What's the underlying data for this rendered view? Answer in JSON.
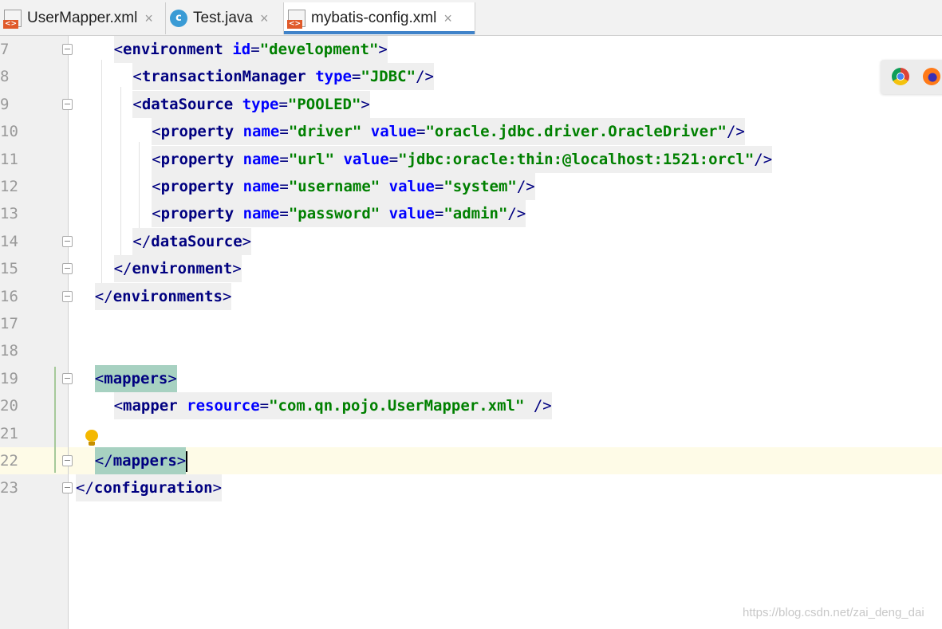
{
  "tabs": [
    {
      "label": "UserMapper.xml",
      "type": "xml",
      "active": false
    },
    {
      "label": "Test.java",
      "type": "java",
      "active": false
    },
    {
      "label": "mybatis-config.xml",
      "type": "xml",
      "active": true
    }
  ],
  "tab_close_glyph": "×",
  "java_icon_glyph": "c",
  "editor": {
    "lines": [
      {
        "n": "7",
        "tokens": [
          [
            "br",
            "<"
          ],
          [
            "tg",
            "environment"
          ],
          [
            "sp",
            " "
          ],
          [
            "at",
            "id"
          ],
          [
            "br",
            "="
          ],
          [
            "vl",
            "\"development\""
          ],
          [
            "br",
            ">"
          ]
        ]
      },
      {
        "n": "8",
        "tokens": [
          [
            "br",
            "<"
          ],
          [
            "tg",
            "transactionManager"
          ],
          [
            "sp",
            " "
          ],
          [
            "at",
            "type"
          ],
          [
            "br",
            "="
          ],
          [
            "vl",
            "\"JDBC\""
          ],
          [
            "br",
            "/>"
          ]
        ]
      },
      {
        "n": "9",
        "tokens": [
          [
            "br",
            "<"
          ],
          [
            "tg",
            "dataSource"
          ],
          [
            "sp",
            " "
          ],
          [
            "at",
            "type"
          ],
          [
            "br",
            "="
          ],
          [
            "vl",
            "\"POOLED\""
          ],
          [
            "br",
            ">"
          ]
        ]
      },
      {
        "n": "10",
        "tokens": [
          [
            "br",
            "<"
          ],
          [
            "tg",
            "property"
          ],
          [
            "sp",
            " "
          ],
          [
            "at",
            "name"
          ],
          [
            "br",
            "="
          ],
          [
            "vl",
            "\"driver\""
          ],
          [
            "sp",
            " "
          ],
          [
            "at",
            "value"
          ],
          [
            "br",
            "="
          ],
          [
            "vl",
            "\"oracle.jdbc.driver.OracleDriver\""
          ],
          [
            "br",
            "/>"
          ]
        ]
      },
      {
        "n": "11",
        "tokens": [
          [
            "br",
            "<"
          ],
          [
            "tg",
            "property"
          ],
          [
            "sp",
            " "
          ],
          [
            "at",
            "name"
          ],
          [
            "br",
            "="
          ],
          [
            "vl",
            "\"url\""
          ],
          [
            "sp",
            " "
          ],
          [
            "at",
            "value"
          ],
          [
            "br",
            "="
          ],
          [
            "vl",
            "\"jdbc:oracle:thin:@localhost:1521:orcl\""
          ],
          [
            "br",
            "/>"
          ]
        ]
      },
      {
        "n": "12",
        "tokens": [
          [
            "br",
            "<"
          ],
          [
            "tg",
            "property"
          ],
          [
            "sp",
            " "
          ],
          [
            "at",
            "name"
          ],
          [
            "br",
            "="
          ],
          [
            "vl",
            "\"username\""
          ],
          [
            "sp",
            " "
          ],
          [
            "at",
            "value"
          ],
          [
            "br",
            "="
          ],
          [
            "vl",
            "\"system\""
          ],
          [
            "br",
            "/>"
          ]
        ]
      },
      {
        "n": "13",
        "tokens": [
          [
            "br",
            "<"
          ],
          [
            "tg",
            "property"
          ],
          [
            "sp",
            " "
          ],
          [
            "at",
            "name"
          ],
          [
            "br",
            "="
          ],
          [
            "vl",
            "\"password\""
          ],
          [
            "sp",
            " "
          ],
          [
            "at",
            "value"
          ],
          [
            "br",
            "="
          ],
          [
            "vl",
            "\"admin\""
          ],
          [
            "br",
            "/>"
          ]
        ]
      },
      {
        "n": "14",
        "tokens": [
          [
            "br",
            "</"
          ],
          [
            "tg",
            "dataSource"
          ],
          [
            "br",
            ">"
          ]
        ]
      },
      {
        "n": "15",
        "tokens": [
          [
            "br",
            "</"
          ],
          [
            "tg",
            "environment"
          ],
          [
            "br",
            ">"
          ]
        ]
      },
      {
        "n": "16",
        "tokens": [
          [
            "br",
            "</"
          ],
          [
            "tg",
            "environments"
          ],
          [
            "br",
            ">"
          ]
        ]
      },
      {
        "n": "17",
        "tokens": []
      },
      {
        "n": "18",
        "tokens": []
      },
      {
        "n": "19",
        "tokens": [
          [
            "br",
            "<"
          ],
          [
            "tg",
            "mappers"
          ],
          [
            "br",
            ">"
          ]
        ],
        "match": true
      },
      {
        "n": "20",
        "tokens": [
          [
            "br",
            "<"
          ],
          [
            "tg",
            "mapper"
          ],
          [
            "sp",
            " "
          ],
          [
            "at",
            "resource"
          ],
          [
            "br",
            "="
          ],
          [
            "vl",
            "\"com.qn.pojo.UserMapper.xml\""
          ],
          [
            "sp",
            " "
          ],
          [
            "br",
            "/>"
          ]
        ]
      },
      {
        "n": "21",
        "tokens": []
      },
      {
        "n": "22",
        "tokens": [
          [
            "br",
            "</"
          ],
          [
            "tg",
            "mappers"
          ],
          [
            "br",
            ">"
          ]
        ],
        "match": true,
        "caret": true,
        "current": true
      },
      {
        "n": "23",
        "tokens": [
          [
            "br",
            "</"
          ],
          [
            "tg",
            "configuration"
          ],
          [
            "br",
            ">"
          ]
        ]
      }
    ]
  },
  "browser_icons": [
    "chrome-icon",
    "firefox-icon"
  ],
  "watermark": "https://blog.csdn.net/zai_deng_dai"
}
